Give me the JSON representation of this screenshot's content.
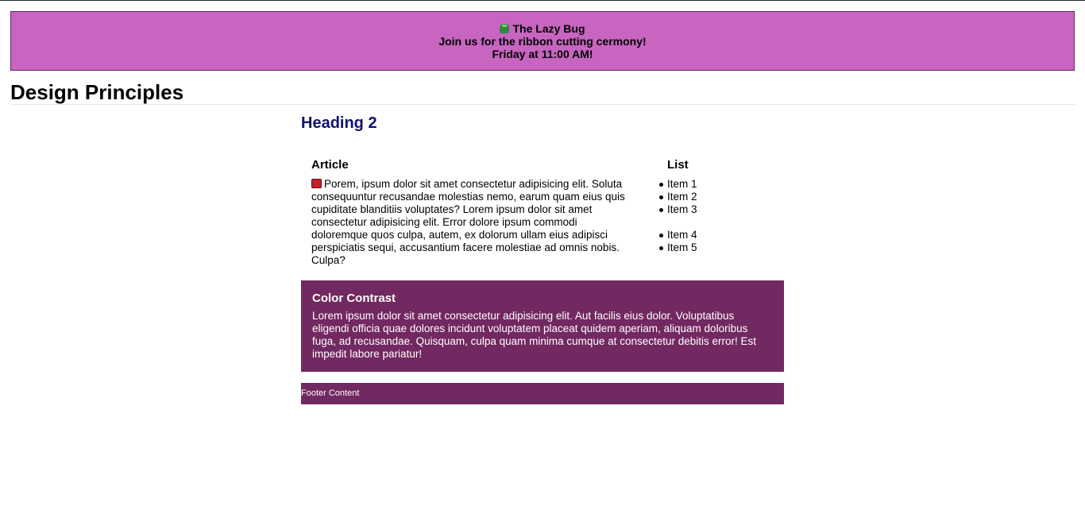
{
  "banner": {
    "name": "The Lazy Bug",
    "announcement": "Join us for the ribbon cutting cermony!",
    "time": "Friday at 11:00 AM!",
    "icon": "bug-icon",
    "background": "#c765c0"
  },
  "page": {
    "title": "Design Principles"
  },
  "main": {
    "heading2": "Heading 2",
    "heading2_color": "#101070"
  },
  "article": {
    "heading": "Article",
    "icon": "book-icon",
    "text": "Porem, ipsum dolor sit amet consectetur adipisicing elit. Soluta consequuntur recusandae molestias nemo, earum quam eius quis cupiditate blanditiis voluptates? Lorem ipsum dolor sit amet consectetur adipisicing elit. Error dolore ipsum commodi doloremque quos culpa, autem, ex dolorum ullam eius adipisci perspiciatis sequi, accusantium facere molestiae ad omnis nobis. Culpa?"
  },
  "list": {
    "heading": "List",
    "items": [
      "Item 1",
      "Item 2",
      "Item 3",
      "Item 4",
      "Item 5"
    ]
  },
  "contrast": {
    "heading": "Color Contrast",
    "text": "Lorem ipsum dolor sit amet consectetur adipisicing elit. Aut facilis eius dolor. Voluptatibus eligendi officia quae dolores incidunt voluptatem placeat quidem aperiam, aliquam doloribus fuga, ad recusandae. Quisquam, culpa quam minima cumque at consectetur debitis error! Est impedit labore pariatur!",
    "background": "#722860"
  },
  "footer": {
    "text": "Footer Content"
  }
}
